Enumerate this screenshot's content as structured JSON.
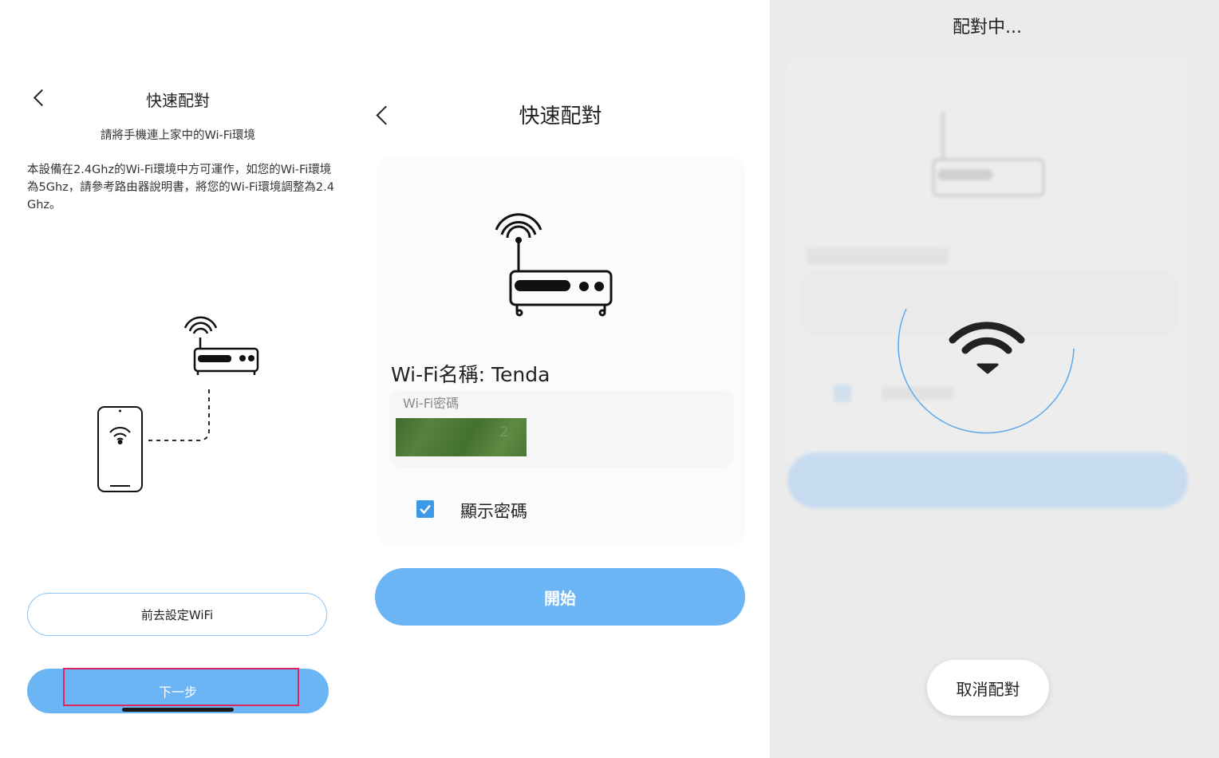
{
  "panel1": {
    "title": "快速配對",
    "subtitle": "請將手機連上家中的Wi-Fi環境",
    "description": "本設備在2.4Ghz的Wi-Fi環境中方可運作，如您的Wi-Fi環境為5Ghz，請參考路由器說明書，將您的Wi-Fi環境調整為2.4Ghz。",
    "goto_wifi_button": "前去設定WiFi",
    "next_button": "下一步"
  },
  "panel2": {
    "title": "快速配對",
    "wifi_name": "Wi-Fi名稱: Tenda",
    "password_label": "Wi-Fi密碼",
    "show_password_label": "顯示密碼",
    "show_password_checked": true,
    "start_button": "開始"
  },
  "panel3": {
    "title": "配對中...",
    "cancel_button": "取消配對"
  },
  "colors": {
    "accent": "#6cb5f5",
    "checkbox": "#3b99e8",
    "highlight": "#e0245e",
    "spinner": "#5ba8ec"
  }
}
